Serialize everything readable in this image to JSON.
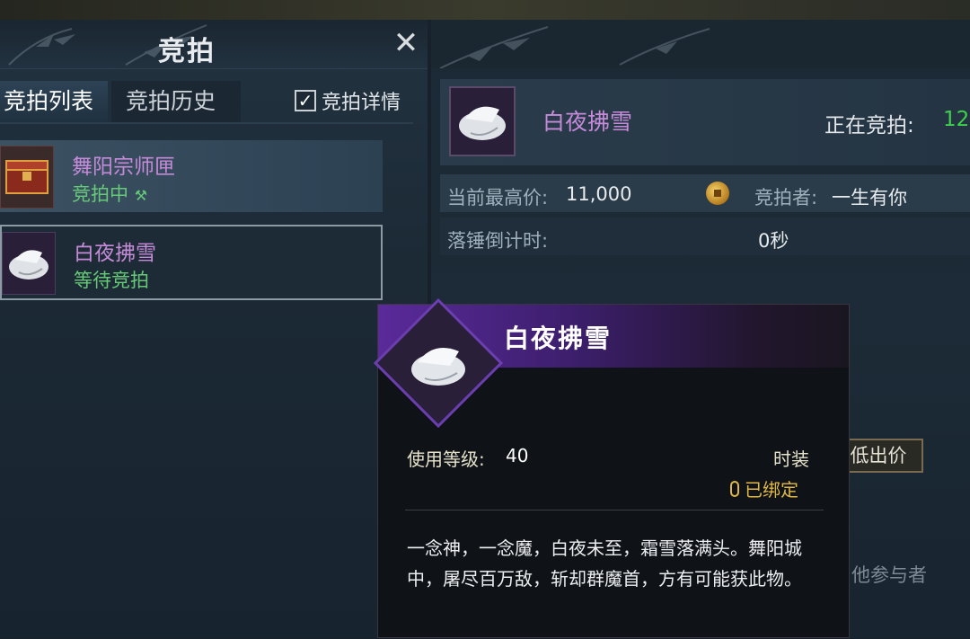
{
  "left_panel": {
    "title": "竞拍",
    "close": "✕",
    "tabs": [
      {
        "label": "竞拍列表",
        "active": true
      },
      {
        "label": "竞拍历史",
        "active": false
      }
    ],
    "details_checkbox": {
      "label": "竞拍详情",
      "checked": true
    },
    "items": [
      {
        "name": "舞阳宗师匣",
        "status": "竞拍中"
      },
      {
        "name": "白夜拂雪",
        "status": "等待竞拍"
      }
    ]
  },
  "right_panel": {
    "item_name": "白夜拂雪",
    "bidding_label": "正在竞拍:",
    "bidding_count": "12",
    "highest_label": "当前最高价:",
    "highest_value": "11,000",
    "bidder_label": "竞拍者:",
    "bidder_name": "一生有你",
    "countdown_label": "落锤倒计时:",
    "countdown_value": "0秒",
    "min_bid_button": "低出价",
    "other_participants": "他参与者"
  },
  "tooltip": {
    "title": "白夜拂雪",
    "level_label": "使用等级:",
    "level_value": "40",
    "type": "时装",
    "bound": "已绑定",
    "description": "一念神，一念魔，白夜未至，霜雪落满头。舞阳城中，屠尽百万敌，斩却群魔首，方有可能获此物。"
  },
  "colors": {
    "item_name": "#c58ad8",
    "status_green": "#66c977",
    "tooltip_header": "#5a2a9a",
    "bound_gold": "#e0b84a"
  }
}
